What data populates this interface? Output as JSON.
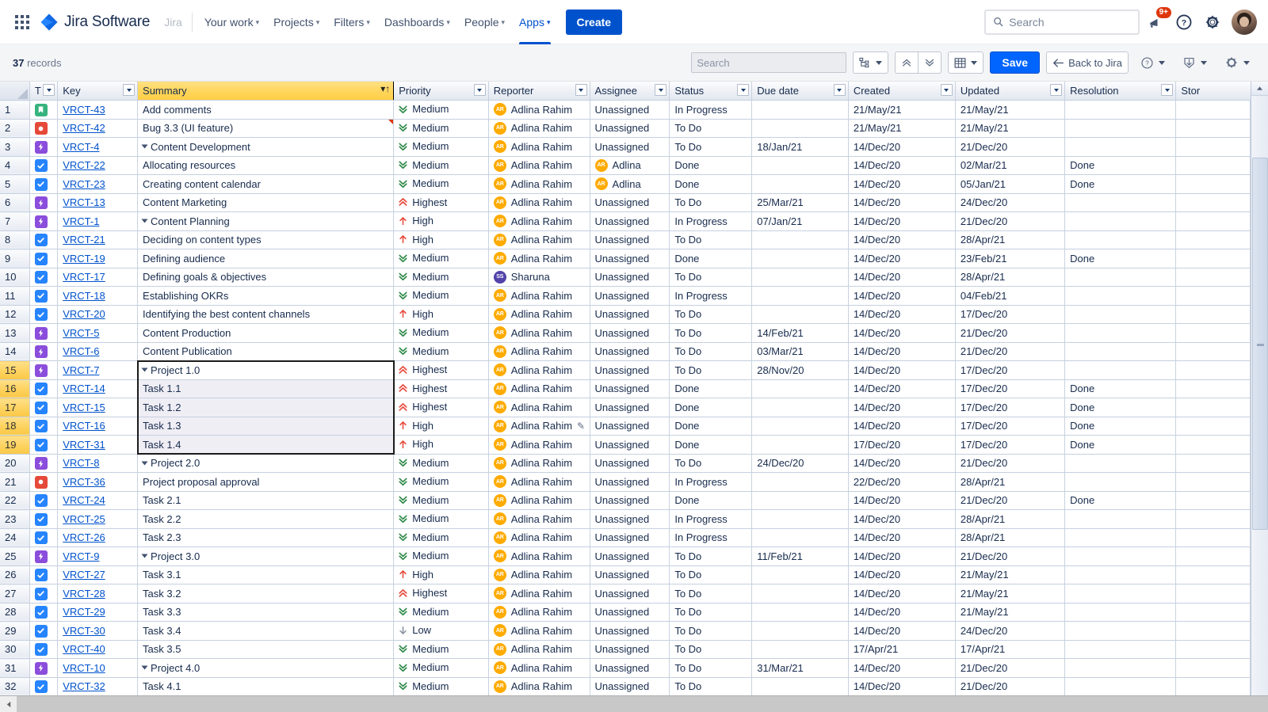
{
  "topnav": {
    "apps_grid_label": "apps-grid",
    "product_name": "Jira Software",
    "site_name": "Jira",
    "items": [
      {
        "label": "Your work",
        "has_caret": true,
        "active": false
      },
      {
        "label": "Projects",
        "has_caret": true,
        "active": false
      },
      {
        "label": "Filters",
        "has_caret": true,
        "active": false
      },
      {
        "label": "Dashboards",
        "has_caret": true,
        "active": false
      },
      {
        "label": "People",
        "has_caret": true,
        "active": false
      },
      {
        "label": "Apps",
        "has_caret": true,
        "active": true
      }
    ],
    "create_label": "Create",
    "search_placeholder": "Search",
    "search_value": "",
    "notification_badge": "9+",
    "help_label": "?",
    "settings_label": "settings"
  },
  "toolbar": {
    "record_count": "37",
    "record_word": "records",
    "search_placeholder": "Search",
    "search_value": "",
    "hierarchy_label": "hierarchy",
    "collapse_all_label": "collapse-all",
    "expand_all_label": "expand-all",
    "columns_label": "columns",
    "save_label": "Save",
    "back_label": "Back to Jira",
    "help_label": "?",
    "export_label": "export",
    "settings_label": "settings"
  },
  "grid": {
    "columns": [
      {
        "key": "t",
        "label": "T"
      },
      {
        "key": "key",
        "label": "Key"
      },
      {
        "key": "summary",
        "label": "Summary",
        "sorted": true,
        "sort_dir": "asc"
      },
      {
        "key": "priority",
        "label": "Priority"
      },
      {
        "key": "reporter",
        "label": "Reporter"
      },
      {
        "key": "assignee",
        "label": "Assignee"
      },
      {
        "key": "status",
        "label": "Status"
      },
      {
        "key": "due",
        "label": "Due date"
      },
      {
        "key": "created",
        "label": "Created"
      },
      {
        "key": "updated",
        "label": "Updated"
      },
      {
        "key": "resolution",
        "label": "Resolution"
      },
      {
        "key": "story",
        "label": "Stor"
      }
    ],
    "colors": {
      "story": "#36b37e",
      "bug": "#e5493a",
      "epic": "#8b4ddb",
      "task": "#2684ff",
      "priority_medium": "#2a8745",
      "priority_high": "#e5493a",
      "priority_highest": "#e5493a",
      "priority_low": "#8993a4",
      "link": "#0052cc",
      "sorted_header": "#ffd65e",
      "selected_rownum": "#fdd15c",
      "accent": "#0052cc"
    },
    "rows": [
      {
        "n": "1",
        "type": "story",
        "key": "VRCT-43",
        "summary": "Add comments",
        "indent": 0,
        "expander": false,
        "priority": "Medium",
        "reporter": "Adlina Rahim",
        "reporter_initials": "AR",
        "reporter_color": "orange",
        "assignee": "Unassigned",
        "assignee_initials": "",
        "status": "In Progress",
        "due": "",
        "created": "21/May/21",
        "updated": "21/May/21",
        "resolution": ""
      },
      {
        "n": "2",
        "type": "bug",
        "key": "VRCT-42",
        "summary": "Bug 3.3 (UI feature)",
        "indent": 0,
        "expander": false,
        "priority": "Medium",
        "reporter": "Adlina Rahim",
        "reporter_initials": "AR",
        "reporter_color": "orange",
        "assignee": "Unassigned",
        "assignee_initials": "",
        "status": "To Do",
        "due": "",
        "created": "21/May/21",
        "updated": "21/May/21",
        "resolution": "",
        "flag": true
      },
      {
        "n": "3",
        "type": "epic",
        "key": "VRCT-4",
        "summary": "Content Development",
        "indent": 0,
        "expander": true,
        "priority": "Medium",
        "reporter": "Adlina Rahim",
        "reporter_initials": "AR",
        "reporter_color": "orange",
        "assignee": "Unassigned",
        "assignee_initials": "",
        "status": "To Do",
        "due": "18/Jan/21",
        "created": "14/Dec/20",
        "updated": "21/Dec/20",
        "resolution": ""
      },
      {
        "n": "4",
        "type": "task",
        "key": "VRCT-22",
        "summary": "Allocating resources",
        "indent": 1,
        "expander": false,
        "priority": "Medium",
        "reporter": "Adlina Rahim",
        "reporter_initials": "AR",
        "reporter_color": "orange",
        "assignee": "Adlina",
        "assignee_initials": "AR",
        "assignee_color": "orange",
        "status": "Done",
        "due": "",
        "created": "14/Dec/20",
        "updated": "02/Mar/21",
        "resolution": "Done"
      },
      {
        "n": "5",
        "type": "task",
        "key": "VRCT-23",
        "summary": "Creating content calendar",
        "indent": 1,
        "expander": false,
        "priority": "Medium",
        "reporter": "Adlina Rahim",
        "reporter_initials": "AR",
        "reporter_color": "orange",
        "assignee": "Adlina",
        "assignee_initials": "AR",
        "assignee_color": "orange",
        "status": "Done",
        "due": "",
        "created": "14/Dec/20",
        "updated": "05/Jan/21",
        "resolution": "Done"
      },
      {
        "n": "6",
        "type": "epic",
        "key": "VRCT-13",
        "summary": "Content Marketing",
        "indent": 0,
        "expander": false,
        "priority": "Highest",
        "reporter": "Adlina Rahim",
        "reporter_initials": "AR",
        "reporter_color": "orange",
        "assignee": "Unassigned",
        "assignee_initials": "",
        "status": "To Do",
        "due": "25/Mar/21",
        "created": "14/Dec/20",
        "updated": "24/Dec/20",
        "resolution": ""
      },
      {
        "n": "7",
        "type": "epic",
        "key": "VRCT-1",
        "summary": "Content Planning",
        "indent": 0,
        "expander": true,
        "priority": "High",
        "reporter": "Adlina Rahim",
        "reporter_initials": "AR",
        "reporter_color": "orange",
        "assignee": "Unassigned",
        "assignee_initials": "",
        "status": "In Progress",
        "due": "07/Jan/21",
        "created": "14/Dec/20",
        "updated": "21/Dec/20",
        "resolution": ""
      },
      {
        "n": "8",
        "type": "task",
        "key": "VRCT-21",
        "summary": "Deciding on content types",
        "indent": 1,
        "expander": false,
        "priority": "High",
        "reporter": "Adlina Rahim",
        "reporter_initials": "AR",
        "reporter_color": "orange",
        "assignee": "Unassigned",
        "assignee_initials": "",
        "status": "To Do",
        "due": "",
        "created": "14/Dec/20",
        "updated": "28/Apr/21",
        "resolution": ""
      },
      {
        "n": "9",
        "type": "task",
        "key": "VRCT-19",
        "summary": "Defining audience",
        "indent": 1,
        "expander": false,
        "priority": "Medium",
        "reporter": "Adlina Rahim",
        "reporter_initials": "AR",
        "reporter_color": "orange",
        "assignee": "Unassigned",
        "assignee_initials": "",
        "status": "Done",
        "due": "",
        "created": "14/Dec/20",
        "updated": "23/Feb/21",
        "resolution": "Done"
      },
      {
        "n": "10",
        "type": "task",
        "key": "VRCT-17",
        "summary": "Defining goals & objectives",
        "indent": 1,
        "expander": false,
        "priority": "Medium",
        "reporter": "Sharuna",
        "reporter_initials": "SS",
        "reporter_color": "purple",
        "assignee": "Unassigned",
        "assignee_initials": "",
        "status": "To Do",
        "due": "",
        "created": "14/Dec/20",
        "updated": "28/Apr/21",
        "resolution": ""
      },
      {
        "n": "11",
        "type": "task",
        "key": "VRCT-18",
        "summary": "Establishing OKRs",
        "indent": 1,
        "expander": false,
        "priority": "Medium",
        "reporter": "Adlina Rahim",
        "reporter_initials": "AR",
        "reporter_color": "orange",
        "assignee": "Unassigned",
        "assignee_initials": "",
        "status": "In Progress",
        "due": "",
        "created": "14/Dec/20",
        "updated": "04/Feb/21",
        "resolution": ""
      },
      {
        "n": "12",
        "type": "task",
        "key": "VRCT-20",
        "summary": "Identifying the best content channels",
        "indent": 1,
        "expander": false,
        "priority": "High",
        "reporter": "Adlina Rahim",
        "reporter_initials": "AR",
        "reporter_color": "orange",
        "assignee": "Unassigned",
        "assignee_initials": "",
        "status": "To Do",
        "due": "",
        "created": "14/Dec/20",
        "updated": "17/Dec/20",
        "resolution": ""
      },
      {
        "n": "13",
        "type": "epic",
        "key": "VRCT-5",
        "summary": "Content Production",
        "indent": 0,
        "expander": false,
        "priority": "Medium",
        "reporter": "Adlina Rahim",
        "reporter_initials": "AR",
        "reporter_color": "orange",
        "assignee": "Unassigned",
        "assignee_initials": "",
        "status": "To Do",
        "due": "14/Feb/21",
        "created": "14/Dec/20",
        "updated": "21/Dec/20",
        "resolution": ""
      },
      {
        "n": "14",
        "type": "epic",
        "key": "VRCT-6",
        "summary": "Content Publication",
        "indent": 0,
        "expander": false,
        "priority": "Medium",
        "reporter": "Adlina Rahim",
        "reporter_initials": "AR",
        "reporter_color": "orange",
        "assignee": "Unassigned",
        "assignee_initials": "",
        "status": "To Do",
        "due": "03/Mar/21",
        "created": "14/Dec/20",
        "updated": "21/Dec/20",
        "resolution": ""
      },
      {
        "n": "15",
        "type": "epic",
        "key": "VRCT-7",
        "summary": "Project 1.0",
        "indent": 0,
        "expander": true,
        "priority": "Highest",
        "reporter": "Adlina Rahim",
        "reporter_initials": "AR",
        "reporter_color": "orange",
        "assignee": "Unassigned",
        "assignee_initials": "",
        "status": "To Do",
        "due": "28/Nov/20",
        "created": "14/Dec/20",
        "updated": "17/Dec/20",
        "resolution": "",
        "selected": true,
        "active": true
      },
      {
        "n": "16",
        "type": "task",
        "key": "VRCT-14",
        "summary": "Task 1.1",
        "indent": 1,
        "expander": false,
        "priority": "Highest",
        "reporter": "Adlina Rahim",
        "reporter_initials": "AR",
        "reporter_color": "orange",
        "assignee": "Unassigned",
        "assignee_initials": "",
        "status": "Done",
        "due": "",
        "created": "14/Dec/20",
        "updated": "17/Dec/20",
        "resolution": "Done",
        "selected": true
      },
      {
        "n": "17",
        "type": "task",
        "key": "VRCT-15",
        "summary": "Task 1.2",
        "indent": 1,
        "expander": false,
        "priority": "Highest",
        "reporter": "Adlina Rahim",
        "reporter_initials": "AR",
        "reporter_color": "orange",
        "assignee": "Unassigned",
        "assignee_initials": "",
        "status": "Done",
        "due": "",
        "created": "14/Dec/20",
        "updated": "17/Dec/20",
        "resolution": "Done",
        "selected": true
      },
      {
        "n": "18",
        "type": "task",
        "key": "VRCT-16",
        "summary": "Task 1.3",
        "indent": 1,
        "expander": false,
        "priority": "High",
        "reporter": "Adlina Rahim",
        "reporter_initials": "AR",
        "reporter_color": "orange",
        "reporter_edit": true,
        "assignee": "Unassigned",
        "assignee_initials": "",
        "status": "Done",
        "due": "",
        "created": "14/Dec/20",
        "updated": "17/Dec/20",
        "resolution": "Done",
        "selected": true
      },
      {
        "n": "19",
        "type": "task",
        "key": "VRCT-31",
        "summary": "Task 1.4",
        "indent": 1,
        "expander": false,
        "priority": "High",
        "reporter": "Adlina Rahim",
        "reporter_initials": "AR",
        "reporter_color": "orange",
        "assignee": "Unassigned",
        "assignee_initials": "",
        "status": "Done",
        "due": "",
        "created": "17/Dec/20",
        "updated": "17/Dec/20",
        "resolution": "Done",
        "selected": true
      },
      {
        "n": "20",
        "type": "epic",
        "key": "VRCT-8",
        "summary": "Project 2.0",
        "indent": 0,
        "expander": true,
        "priority": "Medium",
        "reporter": "Adlina Rahim",
        "reporter_initials": "AR",
        "reporter_color": "orange",
        "assignee": "Unassigned",
        "assignee_initials": "",
        "status": "To Do",
        "due": "24/Dec/20",
        "created": "14/Dec/20",
        "updated": "21/Dec/20",
        "resolution": ""
      },
      {
        "n": "21",
        "type": "bug",
        "key": "VRCT-36",
        "summary": "Project proposal approval",
        "indent": 1,
        "expander": false,
        "priority": "Medium",
        "reporter": "Adlina Rahim",
        "reporter_initials": "AR",
        "reporter_color": "orange",
        "assignee": "Unassigned",
        "assignee_initials": "",
        "status": "In Progress",
        "due": "",
        "created": "22/Dec/20",
        "updated": "28/Apr/21",
        "resolution": ""
      },
      {
        "n": "22",
        "type": "task",
        "key": "VRCT-24",
        "summary": "Task 2.1",
        "indent": 1,
        "expander": false,
        "priority": "Medium",
        "reporter": "Adlina Rahim",
        "reporter_initials": "AR",
        "reporter_color": "orange",
        "assignee": "Unassigned",
        "assignee_initials": "",
        "status": "Done",
        "due": "",
        "created": "14/Dec/20",
        "updated": "21/Dec/20",
        "resolution": "Done"
      },
      {
        "n": "23",
        "type": "task",
        "key": "VRCT-25",
        "summary": "Task 2.2",
        "indent": 1,
        "expander": false,
        "priority": "Medium",
        "reporter": "Adlina Rahim",
        "reporter_initials": "AR",
        "reporter_color": "orange",
        "assignee": "Unassigned",
        "assignee_initials": "",
        "status": "In Progress",
        "due": "",
        "created": "14/Dec/20",
        "updated": "28/Apr/21",
        "resolution": ""
      },
      {
        "n": "24",
        "type": "task",
        "key": "VRCT-26",
        "summary": "Task 2.3",
        "indent": 1,
        "expander": false,
        "priority": "Medium",
        "reporter": "Adlina Rahim",
        "reporter_initials": "AR",
        "reporter_color": "orange",
        "assignee": "Unassigned",
        "assignee_initials": "",
        "status": "In Progress",
        "due": "",
        "created": "14/Dec/20",
        "updated": "28/Apr/21",
        "resolution": ""
      },
      {
        "n": "25",
        "type": "epic",
        "key": "VRCT-9",
        "summary": "Project 3.0",
        "indent": 0,
        "expander": true,
        "priority": "Medium",
        "reporter": "Adlina Rahim",
        "reporter_initials": "AR",
        "reporter_color": "orange",
        "assignee": "Unassigned",
        "assignee_initials": "",
        "status": "To Do",
        "due": "11/Feb/21",
        "created": "14/Dec/20",
        "updated": "21/Dec/20",
        "resolution": ""
      },
      {
        "n": "26",
        "type": "task",
        "key": "VRCT-27",
        "summary": "Task 3.1",
        "indent": 1,
        "expander": false,
        "priority": "High",
        "reporter": "Adlina Rahim",
        "reporter_initials": "AR",
        "reporter_color": "orange",
        "assignee": "Unassigned",
        "assignee_initials": "",
        "status": "To Do",
        "due": "",
        "created": "14/Dec/20",
        "updated": "21/May/21",
        "resolution": ""
      },
      {
        "n": "27",
        "type": "task",
        "key": "VRCT-28",
        "summary": "Task 3.2",
        "indent": 1,
        "expander": false,
        "priority": "Highest",
        "reporter": "Adlina Rahim",
        "reporter_initials": "AR",
        "reporter_color": "orange",
        "assignee": "Unassigned",
        "assignee_initials": "",
        "status": "To Do",
        "due": "",
        "created": "14/Dec/20",
        "updated": "21/May/21",
        "resolution": ""
      },
      {
        "n": "28",
        "type": "task",
        "key": "VRCT-29",
        "summary": "Task 3.3",
        "indent": 1,
        "expander": false,
        "priority": "Medium",
        "reporter": "Adlina Rahim",
        "reporter_initials": "AR",
        "reporter_color": "orange",
        "assignee": "Unassigned",
        "assignee_initials": "",
        "status": "To Do",
        "due": "",
        "created": "14/Dec/20",
        "updated": "21/May/21",
        "resolution": ""
      },
      {
        "n": "29",
        "type": "task",
        "key": "VRCT-30",
        "summary": "Task 3.4",
        "indent": 1,
        "expander": false,
        "priority": "Low",
        "reporter": "Adlina Rahim",
        "reporter_initials": "AR",
        "reporter_color": "orange",
        "assignee": "Unassigned",
        "assignee_initials": "",
        "status": "To Do",
        "due": "",
        "created": "14/Dec/20",
        "updated": "24/Dec/20",
        "resolution": ""
      },
      {
        "n": "30",
        "type": "task",
        "key": "VRCT-40",
        "summary": "Task 3.5",
        "indent": 1,
        "expander": false,
        "priority": "Medium",
        "reporter": "Adlina Rahim",
        "reporter_initials": "AR",
        "reporter_color": "orange",
        "assignee": "Unassigned",
        "assignee_initials": "",
        "status": "To Do",
        "due": "",
        "created": "17/Apr/21",
        "updated": "17/Apr/21",
        "resolution": ""
      },
      {
        "n": "31",
        "type": "epic",
        "key": "VRCT-10",
        "summary": "Project 4.0",
        "indent": 0,
        "expander": true,
        "priority": "Medium",
        "reporter": "Adlina Rahim",
        "reporter_initials": "AR",
        "reporter_color": "orange",
        "assignee": "Unassigned",
        "assignee_initials": "",
        "status": "To Do",
        "due": "31/Mar/21",
        "created": "14/Dec/20",
        "updated": "21/Dec/20",
        "resolution": ""
      },
      {
        "n": "32",
        "type": "task",
        "key": "VRCT-32",
        "summary": "Task 4.1",
        "indent": 1,
        "expander": false,
        "priority": "Medium",
        "reporter": "Adlina Rahim",
        "reporter_initials": "AR",
        "reporter_color": "orange",
        "assignee": "Unassigned",
        "assignee_initials": "",
        "status": "To Do",
        "due": "",
        "created": "14/Dec/20",
        "updated": "21/Dec/20",
        "resolution": "",
        "partial": true
      }
    ]
  }
}
